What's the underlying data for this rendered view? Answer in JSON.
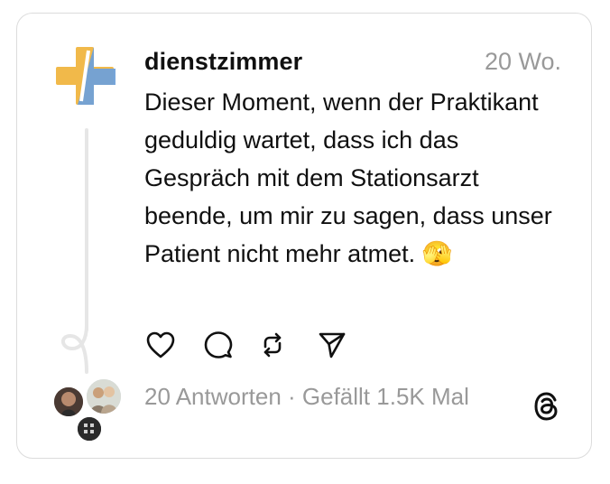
{
  "post": {
    "username": "dienstzimmer",
    "timestamp": "20 Wo.",
    "text": "Dieser Moment, wenn der Praktikant geduldig wartet, dass ich das Gespräch mit dem Stationsarzt beende, um mir zu sagen, dass unser Patient nicht mehr atmet. 🫣"
  },
  "footer": {
    "replies": "20 Antworten",
    "separator": " · ",
    "likes": "Gefällt 1.5K Mal"
  },
  "icons": {
    "like": "heart-icon",
    "reply": "comment-icon",
    "repost": "repost-icon",
    "share": "send-icon",
    "brand": "threads-logo-icon"
  },
  "colors": {
    "avatar_orange": "#f1b94a",
    "avatar_blue": "#6fa0d8",
    "muted_text": "#999999",
    "card_border": "#dcdcdc"
  }
}
